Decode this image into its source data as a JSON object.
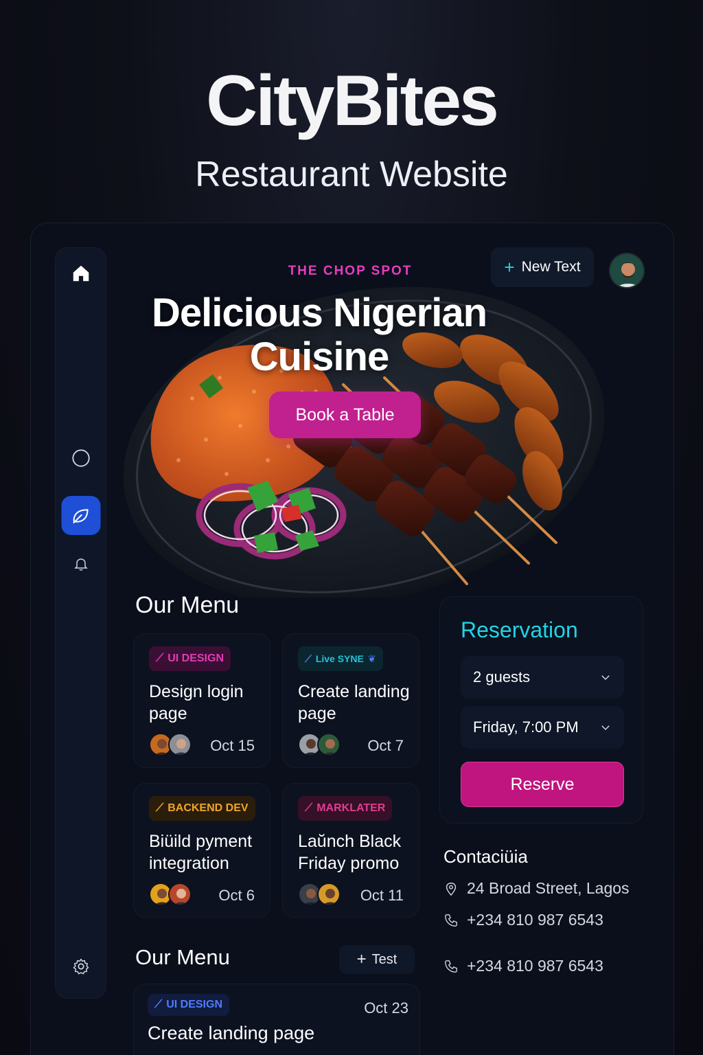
{
  "header": {
    "title": "CityBites",
    "subtitle": "Restaurant Website"
  },
  "sidebar": {
    "items": [
      {
        "icon": "home-icon"
      },
      {
        "icon": "circle-icon"
      },
      {
        "icon": "leaf-icon",
        "active": true
      },
      {
        "icon": "bell-icon"
      },
      {
        "icon": "gear-icon"
      }
    ]
  },
  "hero": {
    "kicker": "THE CHOP SPOT",
    "headline_line1": "Delicious Nigerian",
    "headline_line2": "Cuisine",
    "cta": "Book a Table"
  },
  "topbar": {
    "new_text_label": "New Text"
  },
  "menu": {
    "title": "Our Menu",
    "cards": [
      {
        "tag": "UI DESIGN",
        "title": "Design login page",
        "date": "Oct 15",
        "tag_color": "#e23bb7",
        "tag_bg": "#3a0f34"
      },
      {
        "tag": "Live SYNE",
        "title": "Create landing page",
        "date": "Oct 7",
        "tag_color": "#22c3d8",
        "tag_bg": "#0c2630"
      },
      {
        "tag": "BACKEND DEV",
        "title": "Biüild pyment integration",
        "date": "Oct 6",
        "tag_color": "#f0a52a",
        "tag_bg": "#2a1d0c"
      },
      {
        "tag": "MARKLATER",
        "title": "Laŭnch Black Friday promo",
        "date": "Oct 11",
        "tag_color": "#e23b92",
        "tag_bg": "#351026"
      }
    ]
  },
  "menu2": {
    "title": "Our Menu",
    "test_label": "Test",
    "card": {
      "tag": "UI DESIGN",
      "title": "Create landing page",
      "date": "Oct 23",
      "tag_color": "#4f7cff",
      "tag_bg": "#111c3e"
    }
  },
  "reservation": {
    "title": "Reservation",
    "guests": "2 guests",
    "time": "Friday, 7:00 PM",
    "button": "Reserve"
  },
  "contact": {
    "title": "Contaciüia",
    "address": "24 Broad Street, Lagos",
    "phone1": "+234 810 987 6543",
    "phone2": "+234 810 987 6543"
  },
  "colors": {
    "accent_pink": "#c0218f",
    "accent_cyan": "#22d3e6",
    "accent_blue": "#1f4fd6"
  }
}
